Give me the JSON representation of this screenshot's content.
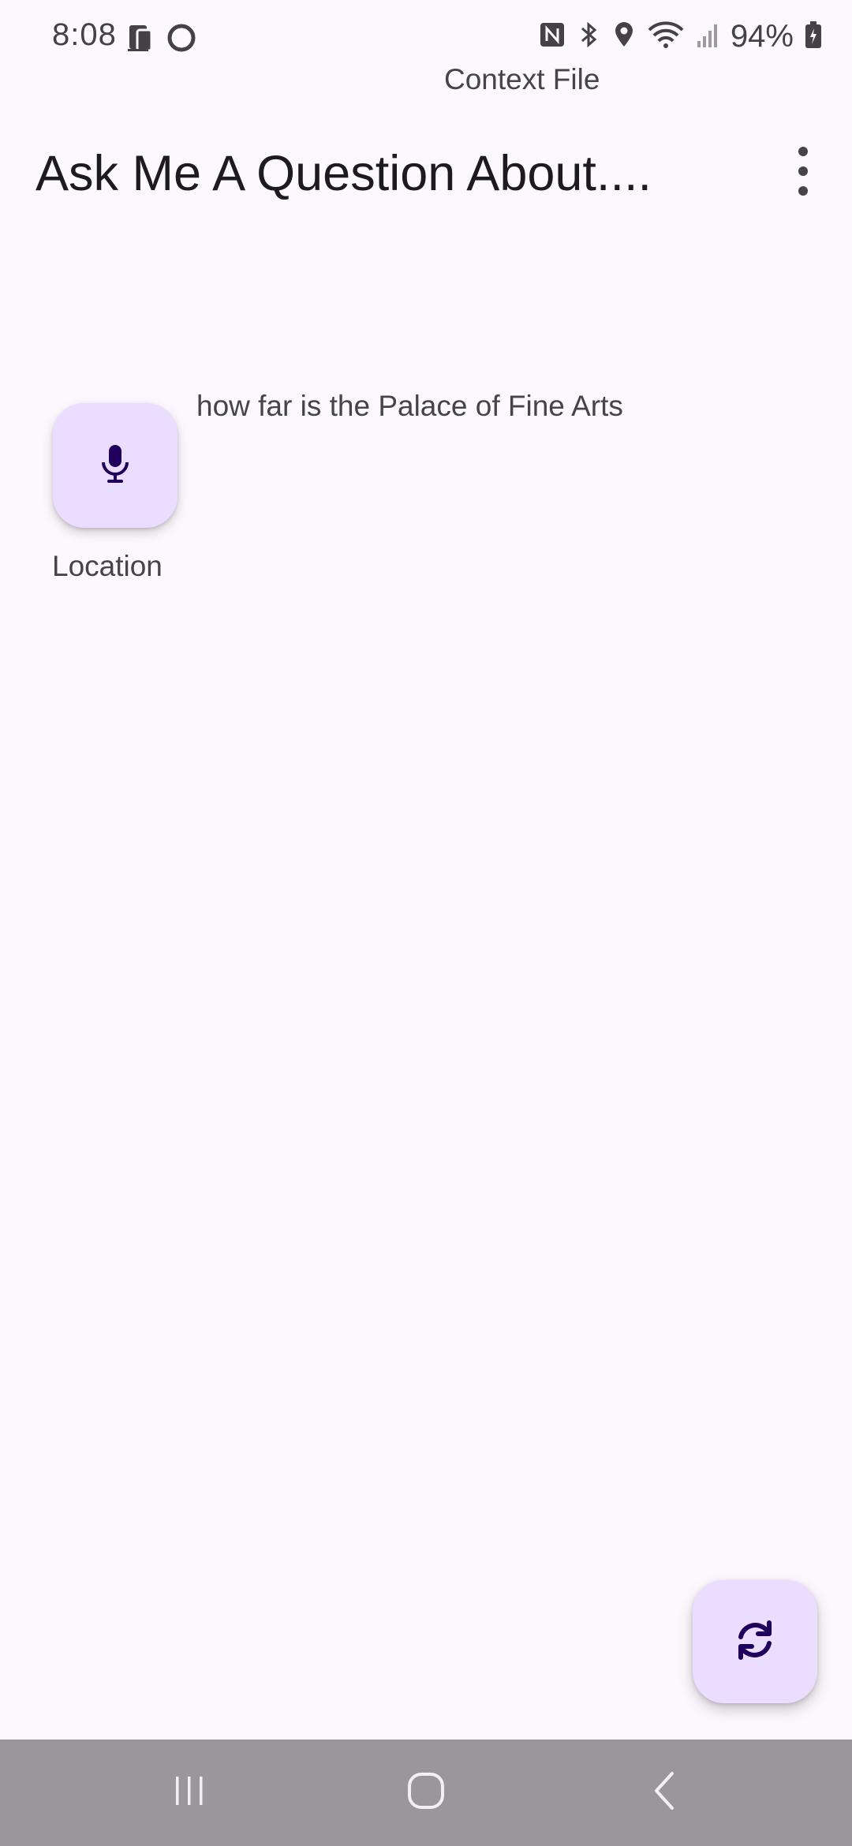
{
  "status_bar": {
    "time": "8:08",
    "battery": "94%",
    "icons": [
      "phone-device-icon",
      "circle-notification-icon",
      "nfc-icon",
      "bluetooth-icon",
      "location-icon",
      "wifi-icon",
      "signal-icon",
      "battery-icon"
    ]
  },
  "header": {
    "context_label": "Context File",
    "title": "Ask Me A Question About....",
    "menu_icon": "more-vert-icon"
  },
  "voice": {
    "button_icon": "microphone-icon",
    "label": "Location",
    "query_text": "how far is the Palace of Fine Arts"
  },
  "fab": {
    "icon": "refresh-icon"
  },
  "nav_bar": {
    "items": [
      "recents-icon",
      "home-icon",
      "back-icon"
    ]
  },
  "colors": {
    "background": "#FDF7FE",
    "button_container": "#EADDFF",
    "on_container": "#21005D",
    "nav_bar": "#9A979C"
  }
}
